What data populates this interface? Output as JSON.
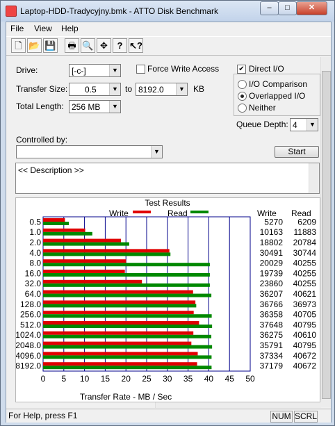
{
  "window": {
    "title": "Laptop-HDD-Tradycyjny.bmk - ATTO Disk Benchmark",
    "minimize": "–",
    "maximize": "□",
    "close": "✕"
  },
  "menu": {
    "file": "File",
    "view": "View",
    "help": "Help"
  },
  "toolbar": [
    "new-file-icon",
    "open-folder-icon",
    "save-icon",
    "print-icon",
    "print-preview-icon",
    "move-icon",
    "help-icon",
    "context-help-icon"
  ],
  "form": {
    "drive_label": "Drive:",
    "drive_value": "[-c-]",
    "force_write_label": "Force Write Access",
    "force_write_checked": false,
    "direct_io_label": "Direct I/O",
    "direct_io_checked": true,
    "transfer_size_label": "Transfer Size:",
    "transfer_from": "0.5",
    "to_label": "to",
    "transfer_to": "8192.0",
    "kb_label": "KB",
    "total_length_label": "Total Length:",
    "total_length_value": "256 MB",
    "io_comparison_label": "I/O Comparison",
    "overlapped_io_label": "Overlapped I/O",
    "neither_label": "Neither",
    "io_mode_selected": "Overlapped I/O",
    "queue_depth_label": "Queue Depth:",
    "queue_depth_value": "4",
    "controlled_by_label": "Controlled by:",
    "controlled_by_value": "",
    "start_button": "Start",
    "description": "<< Description >>"
  },
  "chart_data": {
    "type": "bar",
    "title": "Test Results",
    "legend": {
      "write_label": "Write",
      "read_label": "Read",
      "write_color": "#e00000",
      "read_color": "#008800"
    },
    "col_headers": {
      "write": "Write",
      "read": "Read"
    },
    "xlabel": "Transfer Rate - MB / Sec",
    "xlim": [
      0,
      50
    ],
    "xticks": [
      "0",
      "5",
      "10",
      "15",
      "20",
      "25",
      "30",
      "35",
      "40",
      "45",
      "50"
    ],
    "categories": [
      "0.5",
      "1.0",
      "2.0",
      "4.0",
      "8.0",
      "16.0",
      "32.0",
      "64.0",
      "128.0",
      "256.0",
      "512.0",
      "1024.0",
      "2048.0",
      "4096.0",
      "8192.0"
    ],
    "series": [
      {
        "name": "Write",
        "values": [
          5270,
          10163,
          18802,
          30491,
          20029,
          19739,
          23860,
          36207,
          36766,
          36358,
          37648,
          36275,
          35791,
          37334,
          37179
        ]
      },
      {
        "name": "Read",
        "values": [
          6209,
          11883,
          20784,
          30744,
          40255,
          40255,
          40255,
          40621,
          36973,
          40705,
          40795,
          40610,
          40795,
          40672,
          40672
        ]
      }
    ]
  },
  "status": {
    "text": "For Help, press F1",
    "num": "NUM",
    "scrl": "SCRL"
  }
}
